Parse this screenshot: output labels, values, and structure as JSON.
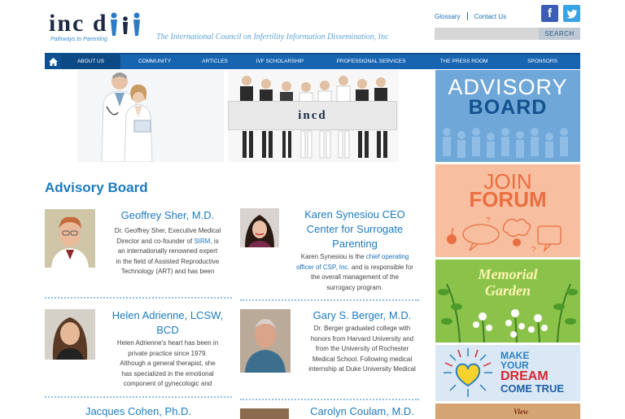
{
  "header": {
    "logo_text": "inc d",
    "logo_tagline": "Pathways to Parenting",
    "council_name": "The International Council on Infertility Information Dissemination, Inc",
    "links": [
      "Glossary",
      "Contact Us"
    ],
    "social": {
      "facebook": "f",
      "twitter": "t"
    },
    "search": {
      "placeholder": "",
      "button": "SEARCH"
    }
  },
  "nav": {
    "home_icon": "home-icon",
    "items": [
      "ABOUT US",
      "COMMUNITY",
      "ARTICLES",
      "IVF SCHOLARSHIP",
      "PROFESSIONAL SERVICES",
      "THE PRESS ROOM",
      "SPONSORS"
    ],
    "active": "ABOUT US"
  },
  "banner": {
    "board_logo": "incd"
  },
  "sidebar": {
    "advisory": [
      "ADVISORY",
      "BOARD"
    ],
    "join": [
      "JOIN",
      "FORUM"
    ],
    "memorial": [
      "Memorial",
      "Garden"
    ],
    "dream": [
      "MAKE",
      "YOUR",
      "DREAM",
      "COME TRUE"
    ],
    "view": "View"
  },
  "content": {
    "title": "Advisory Board",
    "members": [
      {
        "name": [
          "Geoffrey Sher, M.D."
        ],
        "desc": [
          "Dr. Geoffrey Sher, Executive Medical",
          "Director and co-founder of ",
          "SIRM",
          ", is",
          "an internationally renowned expert",
          "in the field of Assisted Reproductive",
          "Technology (ART) and has been"
        ]
      },
      {
        "name": [
          "Karen Synesiou CEO",
          "Center for Surrogate",
          "Parenting"
        ],
        "desc": [
          "Karen Synesiou is the ",
          "chief operating",
          "officer of CSP, Inc.",
          " and is responsible for",
          "the overall management of the",
          "surrogacy program."
        ]
      },
      {
        "name": [
          "Helen Adrienne, LCSW,",
          "BCD"
        ],
        "desc": [
          "Helen Adrienne's heart has been in",
          "private practice since 1979.",
          "Although a general therapist, she",
          "has specialized in the emotional",
          "component of gynecologic and"
        ]
      },
      {
        "name": [
          "Gary S. Berger, M.D."
        ],
        "desc": [
          "Dr. Berger graduated college with",
          "honors from Harvard University and",
          "from the University of Rochester",
          "Medical School. Following medical",
          "internship at Duke University Medical"
        ]
      },
      {
        "name": [
          "Jacques Cohen, Ph.D."
        ]
      },
      {
        "name": [
          "Carolyn Coulam, M.D."
        ]
      }
    ]
  }
}
